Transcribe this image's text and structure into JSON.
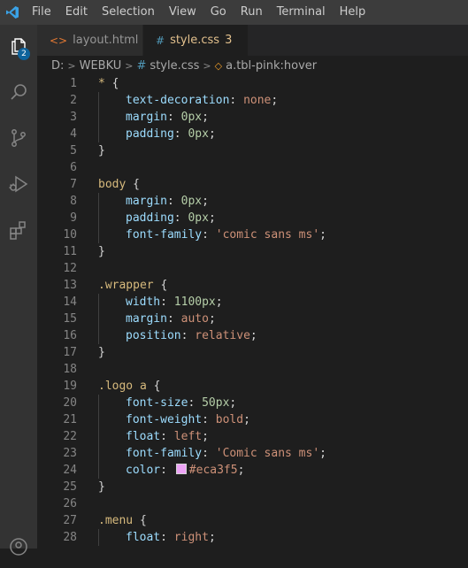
{
  "menu": [
    "File",
    "Edit",
    "Selection",
    "View",
    "Go",
    "Run",
    "Terminal",
    "Help"
  ],
  "activity": {
    "explorer_badge": "2"
  },
  "tabs": [
    {
      "label": "layout.html",
      "icon": "<>",
      "icon_color": "#e37933",
      "active": false
    },
    {
      "label": "style.css",
      "icon": "#",
      "icon_color": "#519aba",
      "problems": "3",
      "active": true
    }
  ],
  "breadcrumb": {
    "drive": "D:",
    "folder": "WEBKU",
    "file": "style.css",
    "symbol": "a.tbl-pink:hover"
  },
  "colors": {
    "accent_modified": "#e2c08d",
    "swatch": "#eca3f5"
  },
  "lines": [
    {
      "n": "1",
      "indent": 0,
      "tokens": [
        [
          "sel",
          "* "
        ],
        [
          "punc",
          "{"
        ]
      ]
    },
    {
      "n": "2",
      "indent": 1,
      "tokens": [
        [
          "prop",
          "text-decoration"
        ],
        [
          "punc",
          ": "
        ],
        [
          "val",
          "none"
        ],
        [
          "punc",
          ";"
        ]
      ]
    },
    {
      "n": "3",
      "indent": 1,
      "tokens": [
        [
          "prop",
          "margin"
        ],
        [
          "punc",
          ": "
        ],
        [
          "num",
          "0px"
        ],
        [
          "punc",
          ";"
        ]
      ]
    },
    {
      "n": "4",
      "indent": 1,
      "tokens": [
        [
          "prop",
          "padding"
        ],
        [
          "punc",
          ": "
        ],
        [
          "num",
          "0px"
        ],
        [
          "punc",
          ";"
        ]
      ]
    },
    {
      "n": "5",
      "indent": 0,
      "tokens": [
        [
          "punc",
          "}"
        ]
      ]
    },
    {
      "n": "6",
      "indent": 0,
      "tokens": []
    },
    {
      "n": "7",
      "indent": 0,
      "tokens": [
        [
          "tag",
          "body "
        ],
        [
          "punc",
          "{"
        ]
      ]
    },
    {
      "n": "8",
      "indent": 1,
      "tokens": [
        [
          "prop",
          "margin"
        ],
        [
          "punc",
          ": "
        ],
        [
          "num",
          "0px"
        ],
        [
          "punc",
          ";"
        ]
      ]
    },
    {
      "n": "9",
      "indent": 1,
      "tokens": [
        [
          "prop",
          "padding"
        ],
        [
          "punc",
          ": "
        ],
        [
          "num",
          "0px"
        ],
        [
          "punc",
          ";"
        ]
      ]
    },
    {
      "n": "10",
      "indent": 1,
      "tokens": [
        [
          "prop",
          "font-family"
        ],
        [
          "punc",
          ": "
        ],
        [
          "val",
          "'comic sans ms'"
        ],
        [
          "punc",
          ";"
        ]
      ]
    },
    {
      "n": "11",
      "indent": 0,
      "tokens": [
        [
          "punc",
          "}"
        ]
      ]
    },
    {
      "n": "12",
      "indent": 0,
      "tokens": []
    },
    {
      "n": "13",
      "indent": 0,
      "tokens": [
        [
          "sel",
          ".wrapper "
        ],
        [
          "punc",
          "{"
        ]
      ]
    },
    {
      "n": "14",
      "indent": 1,
      "tokens": [
        [
          "prop",
          "width"
        ],
        [
          "punc",
          ": "
        ],
        [
          "num",
          "1100px"
        ],
        [
          "punc",
          ";"
        ]
      ]
    },
    {
      "n": "15",
      "indent": 1,
      "tokens": [
        [
          "prop",
          "margin"
        ],
        [
          "punc",
          ": "
        ],
        [
          "val",
          "auto"
        ],
        [
          "punc",
          ";"
        ]
      ]
    },
    {
      "n": "16",
      "indent": 1,
      "tokens": [
        [
          "prop",
          "position"
        ],
        [
          "punc",
          ": "
        ],
        [
          "val",
          "relative"
        ],
        [
          "punc",
          ";"
        ]
      ]
    },
    {
      "n": "17",
      "indent": 0,
      "tokens": [
        [
          "punc",
          "}"
        ]
      ]
    },
    {
      "n": "18",
      "indent": 0,
      "tokens": []
    },
    {
      "n": "19",
      "indent": 0,
      "tokens": [
        [
          "sel",
          ".logo a "
        ],
        [
          "punc",
          "{"
        ]
      ]
    },
    {
      "n": "20",
      "indent": 1,
      "tokens": [
        [
          "prop",
          "font-size"
        ],
        [
          "punc",
          ": "
        ],
        [
          "num",
          "50px"
        ],
        [
          "punc",
          ";"
        ]
      ]
    },
    {
      "n": "21",
      "indent": 1,
      "tokens": [
        [
          "prop",
          "font-weight"
        ],
        [
          "punc",
          ": "
        ],
        [
          "val",
          "bold"
        ],
        [
          "punc",
          ";"
        ]
      ]
    },
    {
      "n": "22",
      "indent": 1,
      "tokens": [
        [
          "prop",
          "float"
        ],
        [
          "punc",
          ": "
        ],
        [
          "val",
          "left"
        ],
        [
          "punc",
          ";"
        ]
      ]
    },
    {
      "n": "23",
      "indent": 1,
      "tokens": [
        [
          "prop",
          "font-family"
        ],
        [
          "punc",
          ": "
        ],
        [
          "val",
          "'Comic sans ms'"
        ],
        [
          "punc",
          ";"
        ]
      ]
    },
    {
      "n": "24",
      "indent": 1,
      "tokens": [
        [
          "prop",
          "color"
        ],
        [
          "punc",
          ": "
        ],
        [
          "swatch",
          ""
        ],
        [
          "val",
          "#eca3f5"
        ],
        [
          "punc",
          ";"
        ]
      ]
    },
    {
      "n": "25",
      "indent": 0,
      "tokens": [
        [
          "punc",
          "}"
        ]
      ]
    },
    {
      "n": "26",
      "indent": 0,
      "tokens": []
    },
    {
      "n": "27",
      "indent": 0,
      "tokens": [
        [
          "sel",
          ".menu "
        ],
        [
          "punc",
          "{"
        ]
      ]
    },
    {
      "n": "28",
      "indent": 1,
      "tokens": [
        [
          "prop",
          "float"
        ],
        [
          "punc",
          ": "
        ],
        [
          "val",
          "right"
        ],
        [
          "punc",
          ";"
        ]
      ]
    }
  ]
}
